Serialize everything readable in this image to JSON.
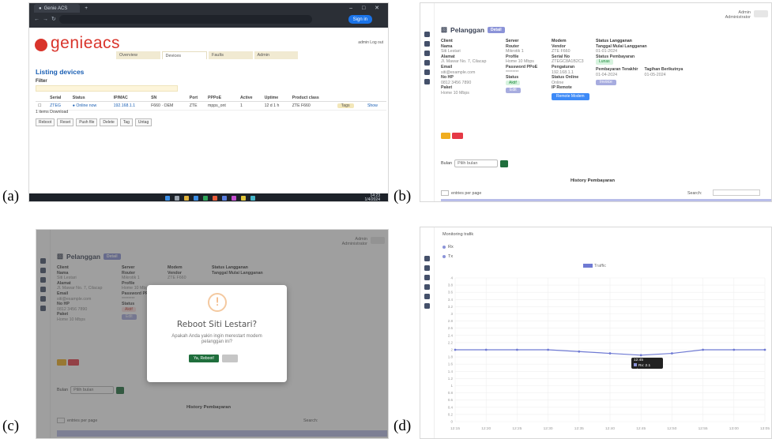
{
  "labels": {
    "a": "(a)",
    "b": "(b)",
    "c": "(c)",
    "d": "(d)"
  },
  "panel_a": {
    "browser_tab": "Genie ACS",
    "address_bar": "",
    "header_button": "Sign in",
    "logo_text": "genieacs",
    "nav_tabs": [
      "Overview",
      "Devices",
      "Faults",
      "Admin"
    ],
    "user_link": "admin  Log out",
    "page_title": "Listing devices",
    "filter_label": "Filter",
    "columns": [
      "",
      "Serial",
      "Status",
      "IP/MAC",
      "SN",
      "Port",
      "PPPoE",
      "Active",
      "Uptime",
      "Product class",
      "",
      ""
    ],
    "row": [
      "",
      "ZTEG",
      "● Online now",
      "192.168.1.1",
      "F660 · OEM",
      "ZTE",
      "mpps_ont",
      "1",
      "12 d 1 h",
      "ZTE F660",
      "Tags",
      "Show"
    ],
    "pager": "1 items  Download",
    "actions": [
      "Reboot",
      "Reset",
      "Push file",
      "Delete",
      "Tag",
      "Untag"
    ],
    "clock_time": "14:23",
    "clock_date": "1/4/2024"
  },
  "panel_b": {
    "top_user": "Admin",
    "top_role": "Administrator",
    "title": "Pelanggan",
    "badge": "Detail",
    "col1": [
      {
        "h": "Client",
        "v": ""
      },
      {
        "h": "Nama",
        "v": "Siti Lestari"
      },
      {
        "h": "Alamat",
        "v": "Jl. Mawar No. 7, Cilacap"
      },
      {
        "h": "Email",
        "v": "siti@example.com"
      },
      {
        "h": "No HP",
        "v": "0812 3456 7890"
      },
      {
        "h": "Paket",
        "v": "Home 10 Mbps"
      }
    ],
    "col2": [
      {
        "h": "Server",
        "v": ""
      },
      {
        "h": "Router",
        "v": "Mikrotik 1"
      },
      {
        "h": "Profile",
        "v": "Home 10 Mbps"
      },
      {
        "h": "Password PPoE",
        "v": "********"
      },
      {
        "h": "Status",
        "v": ""
      }
    ],
    "col3": [
      {
        "h": "Modem",
        "v": ""
      },
      {
        "h": "Vendor",
        "v": "ZTE F660"
      },
      {
        "h": "Serial No",
        "v": "ZTEGC8A1B2C3"
      },
      {
        "h": "Pengaturan",
        "v": "192.168.1.1"
      },
      {
        "h": "Status Online",
        "v": "Online"
      },
      {
        "h": "IP Remote",
        "v": ""
      }
    ],
    "col4": [
      {
        "h": "Status Langganan",
        "v": ""
      },
      {
        "h": "Tanggal Mulai Langganan",
        "v": "01-01-2024"
      },
      {
        "h": "Status Pembayaran",
        "v": ""
      },
      {
        "h": "Pembayaran Terakhir",
        "v": "01-04-2024"
      },
      {
        "h": "Tagihan Berikutnya",
        "v": "01-05-2024"
      }
    ],
    "status_pill": "Aktif",
    "edit_pill": "Edit",
    "remote_pill": "Remote Modem",
    "pay_pill": "Lunas",
    "invoice_pill": "Invoice",
    "filter_label": "Bulan",
    "filter_select": "Pilih bulan",
    "history_title": "History Pembayaran",
    "entries_text": "entries per page",
    "search_label": "Search:"
  },
  "panel_c": {
    "modal_title": "Reboot Siti Lestari?",
    "modal_text": "Apakah Anda yakin ingin merestart modem pelanggan ini?",
    "ok_label": "Ya, Reboot!",
    "cancel_label": ""
  },
  "panel_d": {
    "header": "Monitoring trafik",
    "items": [
      "Rx",
      "Tx"
    ],
    "legend": "Traffic",
    "tooltip_line1": "12:45",
    "tooltip_line2": "Rx: 2.1 Mbps"
  },
  "chart_data": {
    "type": "line",
    "title": "",
    "xlabel": "",
    "ylabel": "",
    "x": [
      "12:15",
      "12:20",
      "12:25",
      "12:30",
      "12:35",
      "12:40",
      "12:45",
      "12:50",
      "12:55",
      "13:00",
      "13:05"
    ],
    "series": [
      {
        "name": "Traffic",
        "values": [
          2.0,
          2.0,
          2.0,
          2.0,
          1.95,
          1.9,
          1.85,
          1.9,
          2.0,
          2.0,
          2.0
        ],
        "color": "#6f7ad3"
      }
    ],
    "ylim": [
      0,
      4
    ],
    "grid": true,
    "legend_position": "top-center"
  },
  "colors": {
    "brand_red": "#d9342b",
    "accent_blue": "#1a5fb4",
    "primary_green": "#1f6e3c",
    "lavender": "#8b93d8"
  }
}
